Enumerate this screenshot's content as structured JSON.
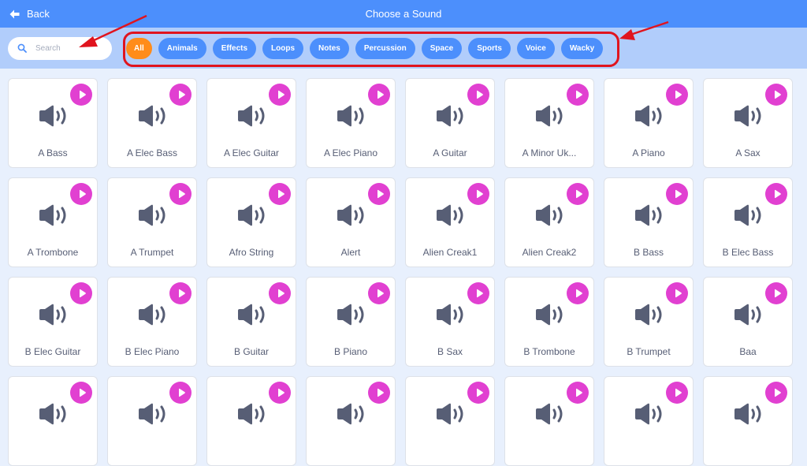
{
  "header": {
    "back_label": "Back",
    "back_icon": "arrow-left-icon",
    "title": "Choose a Sound"
  },
  "search": {
    "placeholder": "Search",
    "value": "",
    "icon": "search-icon"
  },
  "tags": [
    {
      "label": "All",
      "active": true
    },
    {
      "label": "Animals",
      "active": false
    },
    {
      "label": "Effects",
      "active": false
    },
    {
      "label": "Loops",
      "active": false
    },
    {
      "label": "Notes",
      "active": false
    },
    {
      "label": "Percussion",
      "active": false
    },
    {
      "label": "Space",
      "active": false
    },
    {
      "label": "Sports",
      "active": false
    },
    {
      "label": "Voice",
      "active": false
    },
    {
      "label": "Wacky",
      "active": false
    }
  ],
  "colors": {
    "header": "#4c8ffc",
    "filterbar": "#b1cdfb",
    "tag": "#4c8ffc",
    "tag_active": "#ff8c1a",
    "play_button": "#e140d1",
    "annotation": "#e0141e"
  },
  "sounds": [
    {
      "name": "A Bass"
    },
    {
      "name": "A Elec Bass"
    },
    {
      "name": "A Elec Guitar"
    },
    {
      "name": "A Elec Piano"
    },
    {
      "name": "A Guitar"
    },
    {
      "name": "A Minor Uk..."
    },
    {
      "name": "A Piano"
    },
    {
      "name": "A Sax"
    },
    {
      "name": "A Trombone"
    },
    {
      "name": "A Trumpet"
    },
    {
      "name": "Afro String"
    },
    {
      "name": "Alert"
    },
    {
      "name": "Alien Creak1"
    },
    {
      "name": "Alien Creak2"
    },
    {
      "name": "B Bass"
    },
    {
      "name": "B Elec Bass"
    },
    {
      "name": "B Elec Guitar"
    },
    {
      "name": "B Elec Piano"
    },
    {
      "name": "B Guitar"
    },
    {
      "name": "B Piano"
    },
    {
      "name": "B Sax"
    },
    {
      "name": "B Trombone"
    },
    {
      "name": "B Trumpet"
    },
    {
      "name": "Baa"
    },
    {
      "name": ""
    },
    {
      "name": ""
    },
    {
      "name": ""
    },
    {
      "name": ""
    },
    {
      "name": ""
    },
    {
      "name": ""
    },
    {
      "name": ""
    },
    {
      "name": ""
    }
  ],
  "annotations": {
    "arrow_to_search": "red-arrow-icon",
    "arrow_to_tags": "red-arrow-icon",
    "tags_highlight": "red-highlight-box"
  }
}
